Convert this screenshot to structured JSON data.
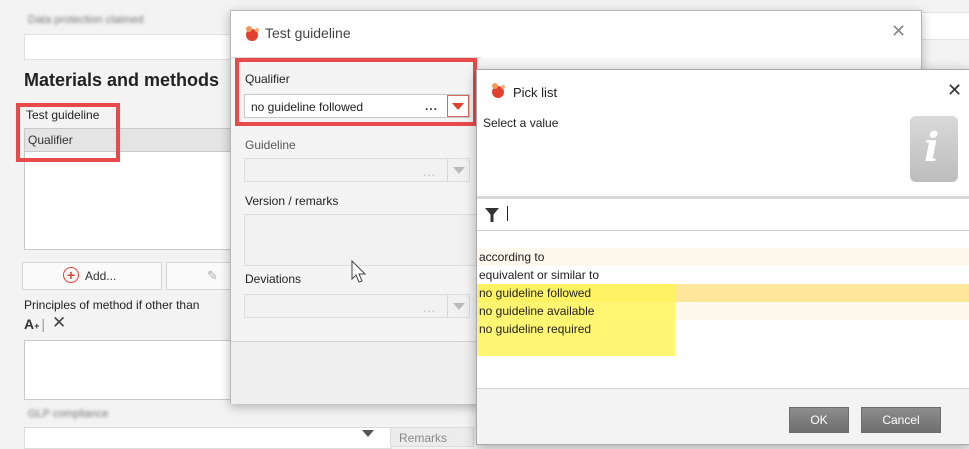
{
  "background": {
    "top_field_label": "Data protection claimed",
    "section_title": "Materials and methods",
    "test_guideline_label": "Test guideline",
    "table_header": "Qualifier",
    "add_label": "Add...",
    "principles_label": "Principles of method if other than",
    "glp_label": "GLP compliance",
    "remarks_label": "Remarks"
  },
  "dialog": {
    "title": "Test guideline",
    "qualifier_label": "Qualifier",
    "qualifier_value": "no guideline followed",
    "guideline_label": "Guideline",
    "version_label": "Version / remarks",
    "deviations_label": "Deviations",
    "dots": "..."
  },
  "picklist": {
    "title": "Pick list",
    "prompt": "Select a value",
    "filter_value": "",
    "options": [
      "according to",
      "equivalent or similar to",
      "no guideline followed",
      "no guideline available",
      "no guideline required"
    ],
    "selected_index": 2,
    "ok_label": "OK",
    "cancel_label": "Cancel"
  },
  "colors": {
    "annotation_red": "#e8494b",
    "highlight_yellow": "#fff45a",
    "selected_row": "#ffe69a",
    "app_icon": "#e2412f"
  }
}
